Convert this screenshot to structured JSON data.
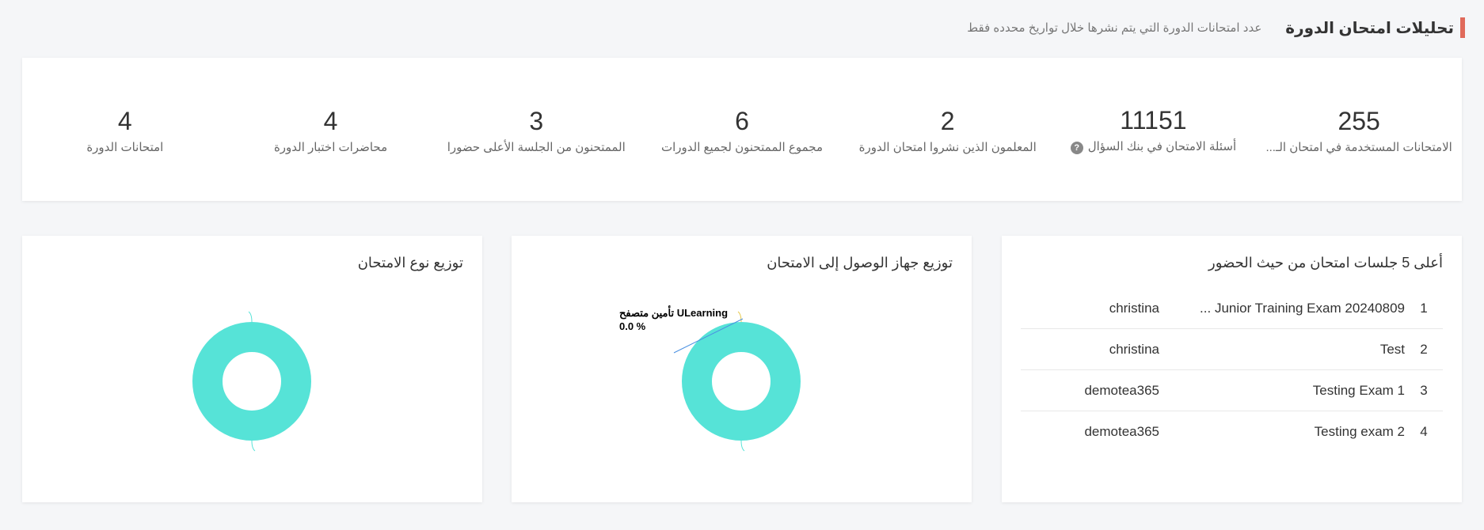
{
  "header": {
    "title": "تحليلات امتحان الدورة",
    "subtitle": "عدد امتحانات الدورة التي يتم نشرها خلال تواريخ محدده فقط"
  },
  "stats": [
    {
      "value": "255",
      "label": "الامتحانات المستخدمة في امتحان الـ..."
    },
    {
      "value": "11151",
      "label": "أسئلة الامتحان في بنك السؤال",
      "help": "?"
    },
    {
      "value": "2",
      "label": "المعلمون الذين نشروا امتحان الدورة"
    },
    {
      "value": "6",
      "label": "مجموع الممتحنون لجميع الدورات"
    },
    {
      "value": "3",
      "label": "الممتحنون من الجلسة الأعلى حضورا"
    },
    {
      "value": "4",
      "label": "محاضرات اختبار الدورة"
    },
    {
      "value": "4",
      "label": "امتحانات الدورة"
    }
  ],
  "top5": {
    "title": "أعلى 5 جلسات امتحان من حيث الحضور",
    "rows": [
      {
        "num": "1",
        "name": "Junior Training Exam 20240809 ...",
        "user": "christina"
      },
      {
        "num": "2",
        "name": "Test",
        "user": "christina"
      },
      {
        "num": "3",
        "name": "Testing Exam 1",
        "user": "demotea365"
      },
      {
        "num": "4",
        "name": "Testing exam 2",
        "user": "demotea365"
      }
    ]
  },
  "device_chart": {
    "title": "توزيع جهاز الوصول إلى الامتحان",
    "label_name": "تأمين متصفح ULearning",
    "label_value": "0.0 %"
  },
  "type_chart": {
    "title": "توزيع نوع الامتحان"
  },
  "chart_data": [
    {
      "type": "pie",
      "title": "توزيع جهاز الوصول إلى الامتحان",
      "slices": [
        {
          "label": "تأمين متصفح ULearning",
          "value": 0.0
        },
        {
          "label": "",
          "value": 100.0
        }
      ]
    },
    {
      "type": "pie",
      "title": "توزيع نوع الامتحان",
      "slices": [
        {
          "label": "",
          "value": 100.0
        }
      ]
    }
  ],
  "colors": {
    "accent": "#e06a5b",
    "donut": "#56e3d7",
    "label_line_blue": "#4a90e2",
    "label_line_yellow": "#e6c84a"
  }
}
